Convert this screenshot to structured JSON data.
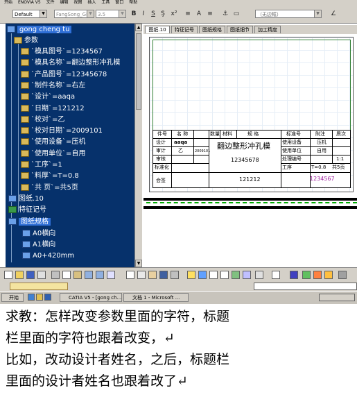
{
  "menubar": {
    "items": [
      "开始",
      "ENOVIA V5",
      "文件",
      "编辑",
      "视图",
      "插入",
      "工具",
      "窗口",
      "帮助"
    ]
  },
  "format_toolbar": {
    "style_combo": "Default",
    "font_combo": "FangSong_GB23",
    "size_combo": "3.5",
    "bold": "B",
    "italic": "I",
    "underline": "S",
    "frame_combo": "（无边框）"
  },
  "tree": {
    "root": "gong cheng tu",
    "params_label": "参数",
    "params": [
      "`模具图号`=1234567",
      "`模具名称`=翻边整形冲孔模",
      "`产品图号`=12345678",
      "`制件名称`=右左",
      "`设计`=aaqa",
      "`日期`=121212",
      "`校对`=乙",
      "`校对日期`=2009101",
      "`使用设备`=压机",
      "`使用单位`=自用",
      "`工序`=1",
      "`料厚`=T=0.8",
      "`共  页`=共5页"
    ],
    "drawing_sheet": "图纸.10",
    "feature_marks": "特征记号",
    "drawing_spec": "图纸规格",
    "sub": [
      "A0横向",
      "A1横向",
      "A0+420mm"
    ]
  },
  "tabs": [
    "图纸.10",
    "特征记号",
    "图纸规格",
    "图纸细节",
    "加工精度"
  ],
  "title_block": {
    "headers": [
      "件号",
      "名    称",
      "数量",
      "材料",
      "规  格",
      "标准号",
      "附注",
      "质次"
    ],
    "labels": [
      "设计",
      "审计",
      "审核",
      "标准化",
      "会签"
    ],
    "design_value": "aaqa",
    "check_value": "乙",
    "check_date": "2009101",
    "mold_name": "翻边整形冲孔模",
    "product_no": "12345678",
    "date": "121212",
    "mold_no": "1234567",
    "right_labels": [
      "使用设备",
      "使用单位",
      "处理编号",
      "工序",
      "T=0.8",
      "共5页"
    ],
    "right_values": [
      "压机",
      "自用",
      "1:1"
    ]
  },
  "taskbar": {
    "start": "开始",
    "tasks": [
      "CATIA V5 - [gong ch...",
      "文档 1 - Microsoft ..."
    ]
  },
  "post": {
    "lines": [
      "求教：怎样改变参数里面的字符，标题",
      "栏里面的字符也跟着改变，↵",
      "比如，改动设计者姓名，之后，标题栏",
      "里面的设计者姓名也跟着改了↵"
    ]
  },
  "colors": {
    "tree_bg": "#06316b",
    "title_magenta": "#a020a0",
    "frame_green": "#2e7d32"
  }
}
